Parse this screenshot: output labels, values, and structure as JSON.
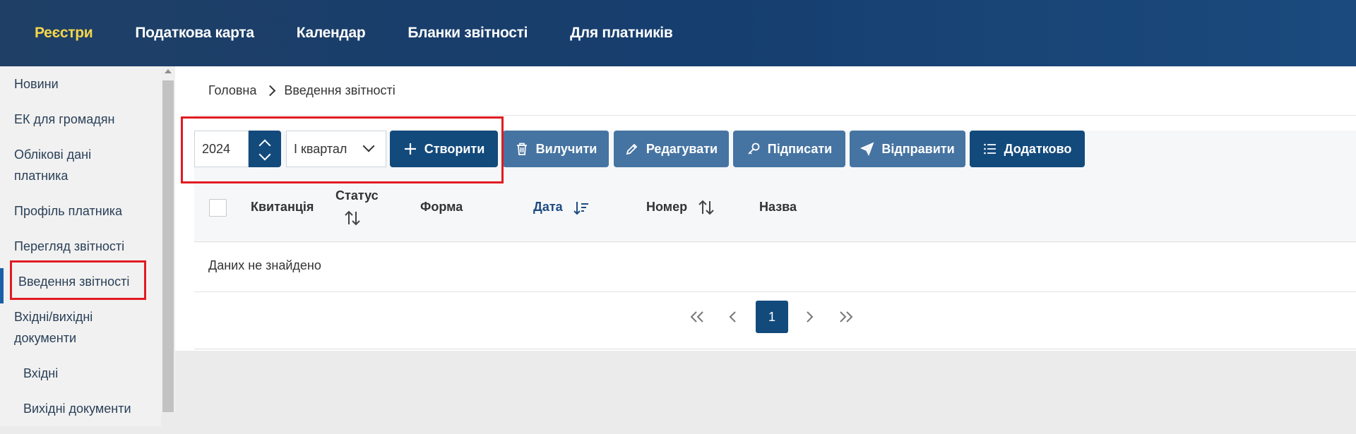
{
  "topnav": {
    "items": [
      {
        "label": "Реєстри",
        "active": true
      },
      {
        "label": "Податкова карта",
        "active": false
      },
      {
        "label": "Календар",
        "active": false
      },
      {
        "label": "Бланки звітності",
        "active": false
      },
      {
        "label": "Для платників",
        "active": false
      }
    ]
  },
  "sidebar": {
    "items": [
      {
        "label": "Новини"
      },
      {
        "label": "ЕК для громадян"
      },
      {
        "label": "Облікові дані платника"
      },
      {
        "label": "Профіль платника"
      },
      {
        "label": "Перегляд звітності"
      },
      {
        "label": "Введення звітності",
        "active": true
      },
      {
        "label": "Вхідні/вихідні документи"
      },
      {
        "label": "Вхідні"
      },
      {
        "label": "Вихідні документи"
      }
    ]
  },
  "breadcrumb": {
    "home": "Головна",
    "current": "Введення звітності"
  },
  "toolbar": {
    "year": "2024",
    "quarter": "I квартал",
    "create": "Створити",
    "remove": "Вилучити",
    "edit": "Редагувати",
    "sign": "Підписати",
    "send": "Відправити",
    "more": "Додатково"
  },
  "table": {
    "columns": {
      "receipt": "Квитанція",
      "status": "Статус",
      "form": "Форма",
      "date": "Дата",
      "number": "Номер",
      "name": "Назва"
    },
    "empty": "Даних не знайдено"
  },
  "pagination": {
    "current_page": "1"
  },
  "colors": {
    "nav_bg": "#163e6e",
    "nav_active": "#f5d64a",
    "primary": "#134a7c",
    "muted": "#4674a2",
    "highlight": "#e11b22"
  }
}
